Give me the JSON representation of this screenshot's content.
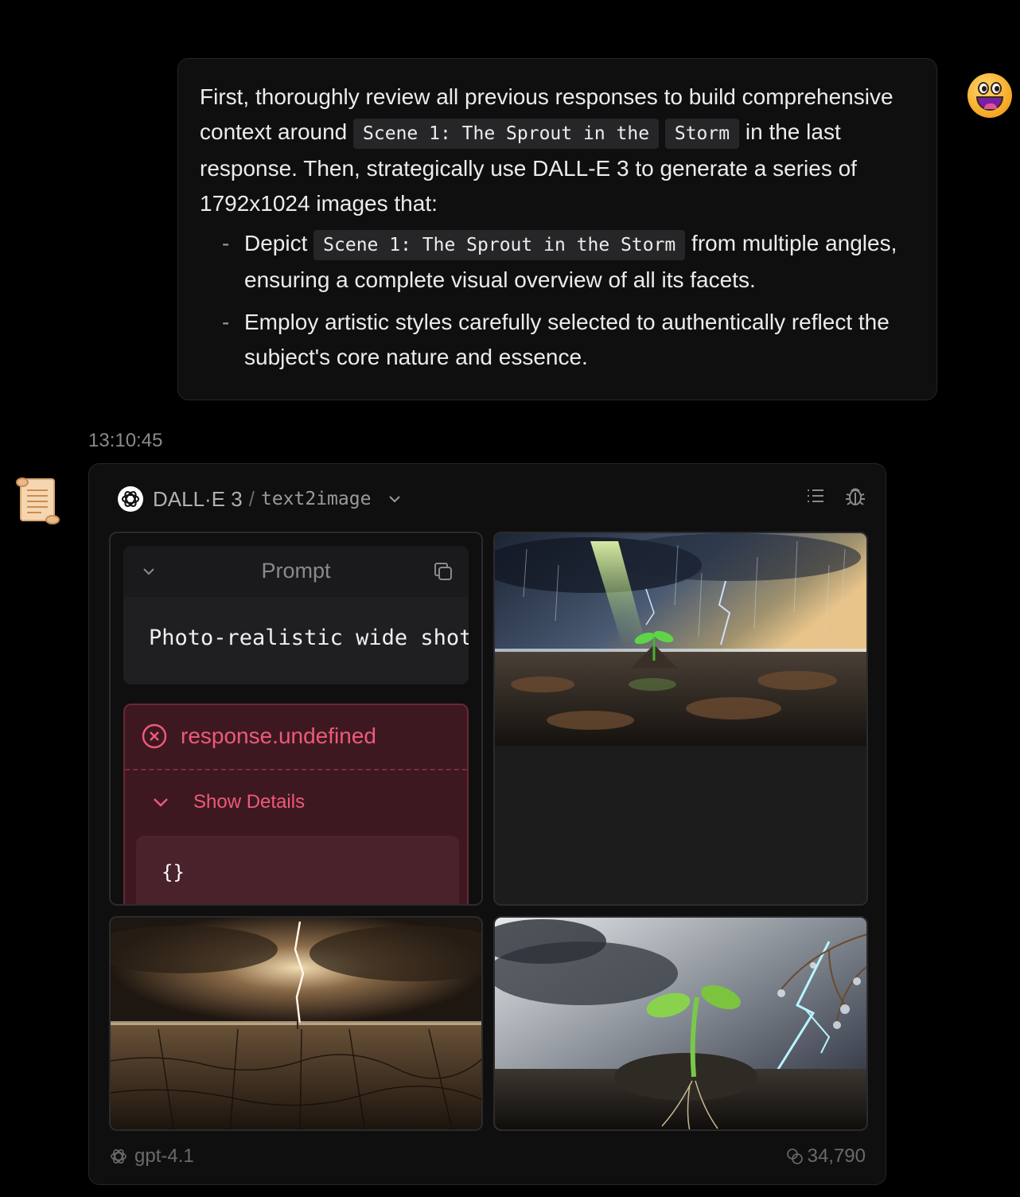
{
  "user_message": {
    "para_1": "First, thoroughly review all previous responses to build comprehensive context around",
    "code_1a": "Scene 1: The Sprout in the",
    "code_1b": "Storm",
    "para_2": "in the last response. Then, strategically use DALL-E 3 to generate a series of 1792x1024 images that:",
    "bullets": [
      {
        "dash": "-",
        "prefix": "Depict",
        "code": "Scene 1: The Sprout in the Storm",
        "suffix": "from multiple angles, ensuring a complete visual overview of all its facets."
      },
      {
        "dash": "-",
        "text": "Employ artistic styles carefully selected to authentically reflect the subject's core nature and essence."
      }
    ]
  },
  "timestamp": "13:10:45",
  "assistant": {
    "header": {
      "model": "DALL·E 3",
      "separator": "/",
      "plugin": "text2image"
    },
    "prompt": {
      "title": "Prompt",
      "text": "Photo-realistic wide shot of a tiny green sprout emerging from cracked earth during a violent storm"
    },
    "error": {
      "title": "response.undefined",
      "details_label": "Show Details",
      "json": "{}"
    },
    "images": [
      {
        "name": "sprout-storm-lightbeam"
      },
      {
        "name": "cracked-earth-storm"
      },
      {
        "name": "sprout-rain-lightning-closeup"
      }
    ],
    "footer": {
      "model": "gpt-4.1",
      "tokens": "34,790"
    }
  },
  "colors": {
    "background": "#000000",
    "card": "#0f0f10",
    "error_text": "#ee5a78",
    "error_bg": "#3d1821"
  }
}
